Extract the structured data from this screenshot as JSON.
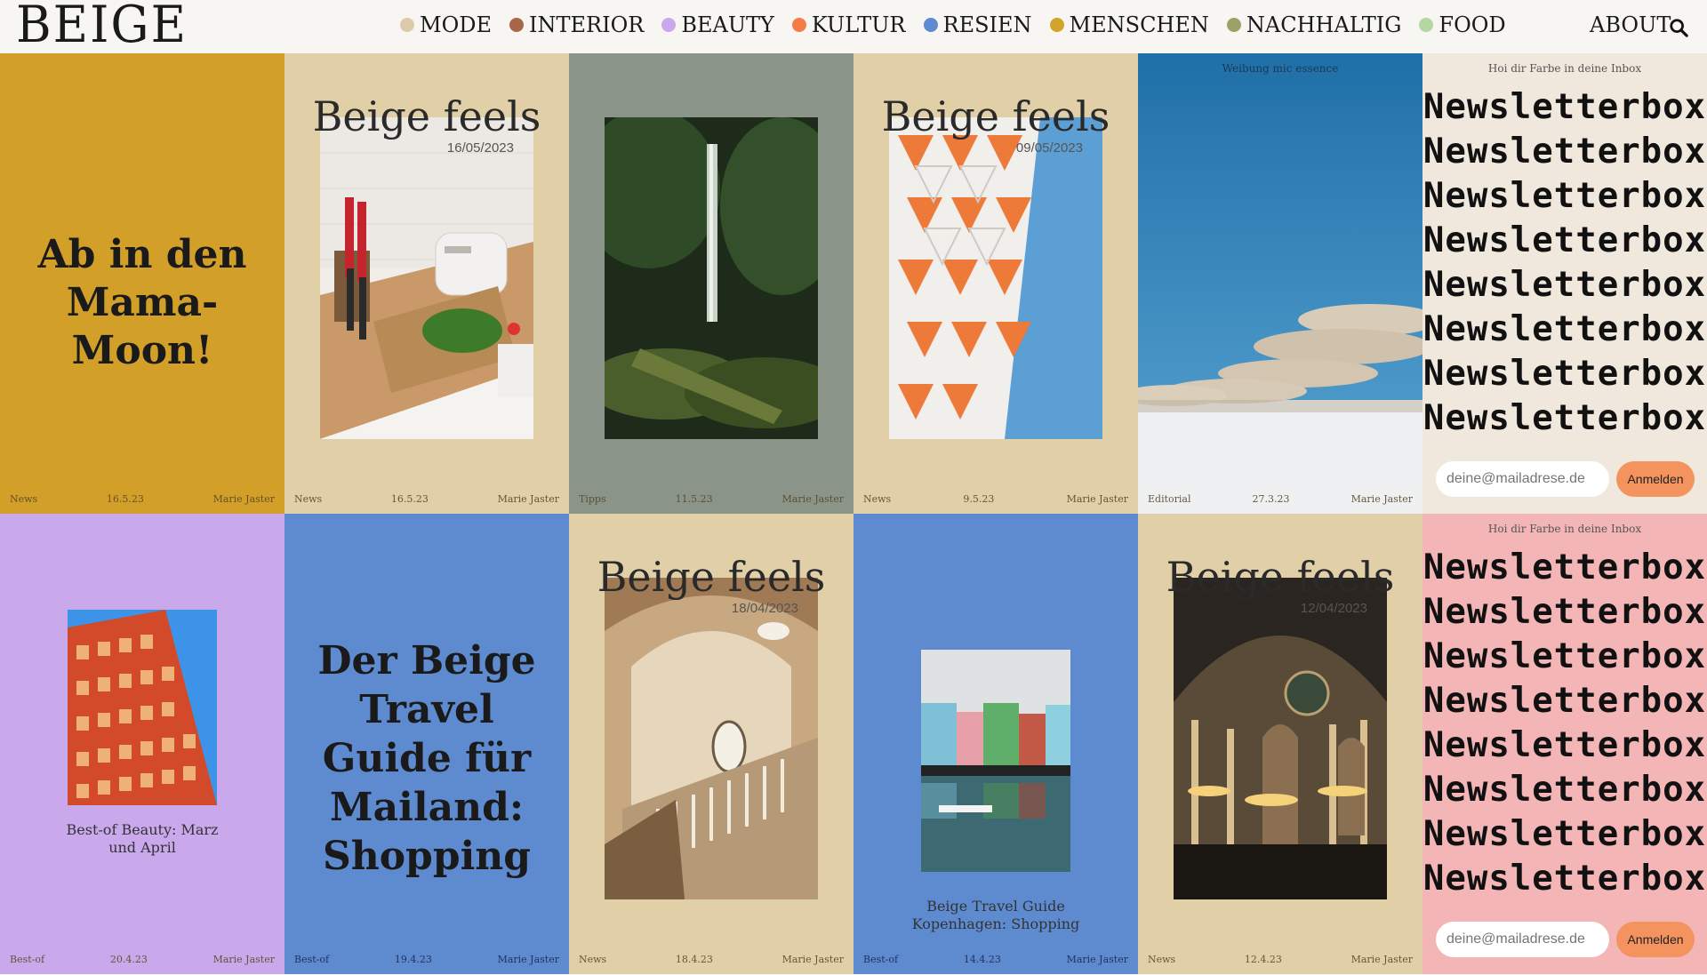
{
  "header": {
    "logo": "BEIGE",
    "nav": [
      {
        "label": "MODE",
        "color": "#dccbaa"
      },
      {
        "label": "INTERIOR",
        "color": "#a8664a"
      },
      {
        "label": "BEAUTY",
        "color": "#c9a8ec"
      },
      {
        "label": "KULTUR",
        "color": "#f47c48"
      },
      {
        "label": "RESIEN",
        "color": "#5e8ad0"
      },
      {
        "label": "MENSCHEN",
        "color": "#d4a42a"
      },
      {
        "label": "NACHHALTIG",
        "color": "#9ea06a"
      },
      {
        "label": "FOOD",
        "color": "#b4d7a2"
      }
    ],
    "about": "ABOUT",
    "search_icon": "search-icon"
  },
  "cards": [
    {
      "title": "Ab in den Mama-Moon!",
      "tag": "News",
      "date": "16.5.23",
      "author": "Marie Jaster",
      "bg": "#d29f28"
    },
    {
      "title": "Beige feels",
      "post_date": "16/05/2023",
      "tag": "News",
      "date": "16.5.23",
      "author": "Marie Jaster",
      "bg": "#e1cfa8"
    },
    {
      "tag": "Tipps",
      "date": "11.5.23",
      "author": "Marie Jaster",
      "bg": "#8a9488"
    },
    {
      "title": "Beige feels",
      "post_date": "09/05/2023",
      "tag": "News",
      "date": "9.5.23",
      "author": "Marie Jaster",
      "bg": "#e1cfa8"
    },
    {
      "ad_label": "Weibung mic essence",
      "tag": "Editorial",
      "date": "27.3.23",
      "author": "Marie Jaster",
      "bg": "#3a8ec8"
    },
    {
      "headline": "Hoi dir Farbe in deine Inbox",
      "word": "Newsletterbox",
      "placeholder": "deine@mailadrese.de",
      "button": "Anmelden",
      "bg": "#f0e8dc"
    },
    {
      "caption": "Best-of Beauty: Marz und April",
      "tag": "Best-of",
      "date": "20.4.23",
      "author": "Marie Jaster",
      "bg": "#c9a8ec"
    },
    {
      "title": "Der Beige Travel Guide für Mailand: Shopping",
      "tag": "Best-of",
      "date": "19.4.23",
      "author": "Marie Jaster",
      "bg": "#5e8ad0"
    },
    {
      "title": "Beige feels",
      "post_date": "18/04/2023",
      "tag": "News",
      "date": "18.4.23",
      "author": "Marie Jaster",
      "bg": "#e1cfa8"
    },
    {
      "caption": "Beige Travel Guide Kopenhagen: Shopping",
      "tag": "Best-of",
      "date": "14.4.23",
      "author": "Marie Jaster",
      "bg": "#5e8ad0"
    },
    {
      "title": "Beige feels",
      "post_date": "12/04/2023",
      "tag": "News",
      "date": "12.4.23",
      "author": "Marie Jaster",
      "bg": "#e1cfa8"
    },
    {
      "headline": "Hoi dir Farbe in deine Inbox",
      "word": "Newsletterbox",
      "placeholder": "deine@mailadrese.de",
      "button": "Anmelden",
      "bg": "#f3b5b5"
    }
  ]
}
